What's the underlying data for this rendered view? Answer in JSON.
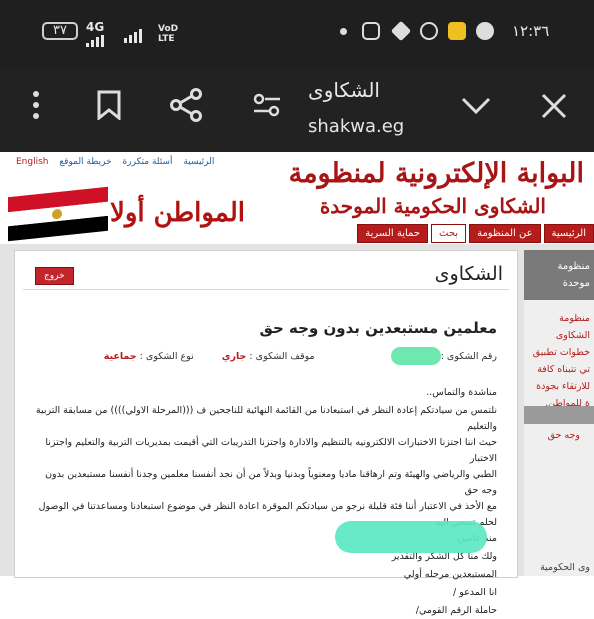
{
  "statusbar": {
    "battery": "٣٧",
    "network": "4G",
    "carrier": "VoD LTE",
    "time": "١٢:٣٦",
    "icons": [
      "dot-icon",
      "instagram-icon",
      "box-icon",
      "browser-icon",
      "app-icon",
      "chat-icon"
    ]
  },
  "browser": {
    "page_title": "الشكاوى",
    "host": "shakwa.eg",
    "icons": [
      "more-icon",
      "bookmark-icon",
      "share-icon",
      "tune-icon",
      "chevron-down-icon",
      "close-icon"
    ]
  },
  "site": {
    "toplinks": [
      "English",
      "الرئيسية",
      "أسئلة متكررة",
      "خريطة الموقع"
    ],
    "logo_line1": "البوابة الإلكترونية لمنظومة",
    "logo_line2": "الشكاوى الحكومية الموحدة",
    "slogan": "المواطن أولا",
    "flag_colors": [
      "#ce1126",
      "#ffffff",
      "#000000"
    ],
    "nav": [
      "الرئيسية",
      "عن المنظومة",
      "بحث",
      "حماية السرية"
    ]
  },
  "sidebar": {
    "head": [
      "منظومة",
      "موحدة"
    ],
    "text": [
      "منظومة الشكاوى",
      "خطوات تطبيق",
      "تي تتبناه كافة",
      "للارتقاء بجودة",
      "ة للمواطن."
    ],
    "link": "وجه حق",
    "bottom": "وى الحكومية"
  },
  "complaint": {
    "section_title": "الشكاوى",
    "logout": "خروج",
    "subject": "معلمين مستبعدين بدون وجه حق",
    "number_label": "رقم الشكوى :",
    "status_label": "موقف الشكوى :",
    "status_value": "جاري",
    "type_label": "نوع الشكوى :",
    "type_value": "جماعية",
    "body": [
      "مناشدة والتماس..",
      "نلتمس من سيادتكم إعادة النظر في استبعادنا من القائمة النهائية للناجحين ف (((المرحلة الاولي)))) من مسابقة التربية والتعليم",
      "حيث اننا اجتزنا الاختبارات الالكترونيه بالتنظيم والادارة واجتزنا التدريبات التي أقيمت بمديريات التربية والتعليم واجتزنا الاختبار",
      "الطبي والرياضي والهيئة وتم ارهاقنا ماديا ومعنوياً وبدنيا وبدلاً من أن نجد أنفسنا معلمين وجدنا أنفسنا مستبعدين بدون وجه حق",
      "مع الأخذ في الاعتبار أننا فئة قليلة نرجو من سيادتكم الموقرة اعادة النظر في موضوع استبعادنا ومساعدتنا في الوصول لحلم تسعي اليه",
      "منذ عامين.",
      "ولك منا كل الشكر والتقدير",
      "المستبعدين مرحله أولي",
      "انا المدعو /",
      "حاملة الرقم القومي/"
    ]
  }
}
